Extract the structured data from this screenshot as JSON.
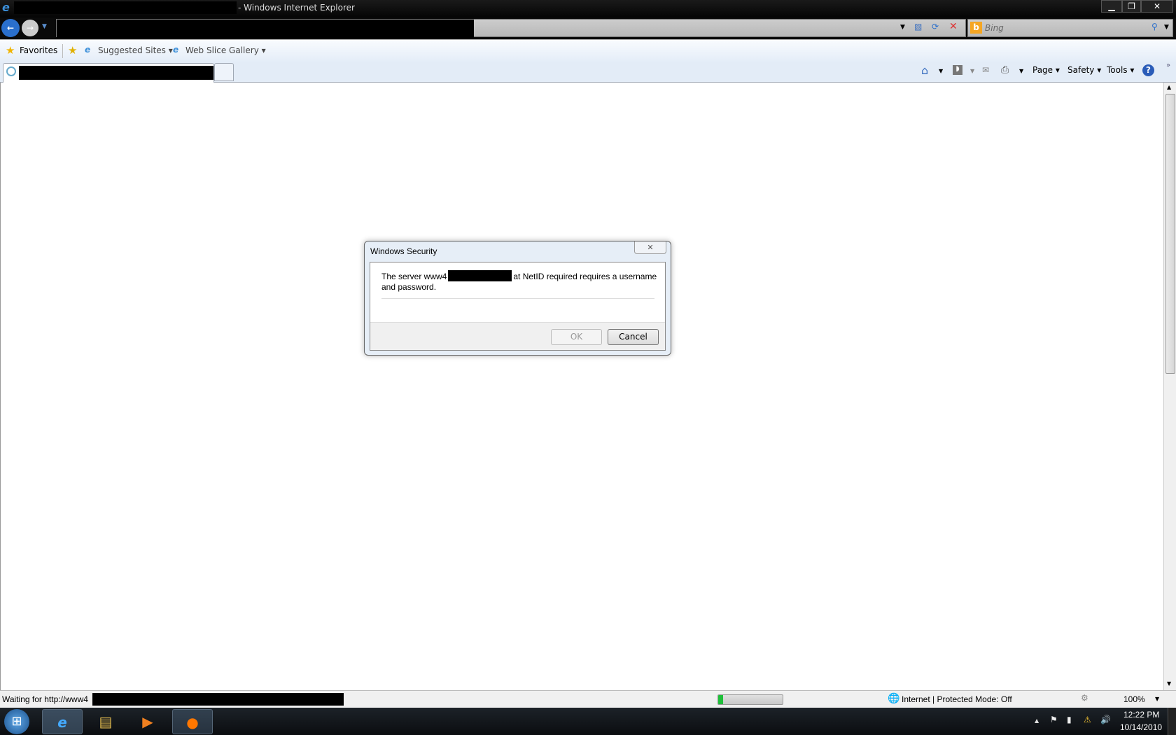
{
  "window": {
    "title_suffix": "- Windows Internet Explorer",
    "minimize": "▁",
    "restore": "❐",
    "close": "✕"
  },
  "search": {
    "placeholder": "Bing"
  },
  "favorites": {
    "favorites_label": "Favorites",
    "items": [
      {
        "label": "Suggested Sites ▾"
      },
      {
        "label": "Web Slice Gallery ▾"
      }
    ]
  },
  "commandbar": {
    "page": "Page ▾",
    "safety": "Safety ▾",
    "tools": "Tools ▾",
    "help": "?"
  },
  "dialog": {
    "title": "Windows Security",
    "message_prefix": "The server www4",
    "message_suffix": "at NetID required requires a username",
    "message_line2": "and password.",
    "ok": "OK",
    "cancel": "Cancel",
    "close": "✕"
  },
  "status": {
    "text": "Waiting for http://www4",
    "zone": "Internet | Protected Mode: Off",
    "zoom": "100%",
    "progress_percent": 8
  },
  "taskbar": {
    "time": "12:22 PM",
    "date": "10/14/2010"
  }
}
